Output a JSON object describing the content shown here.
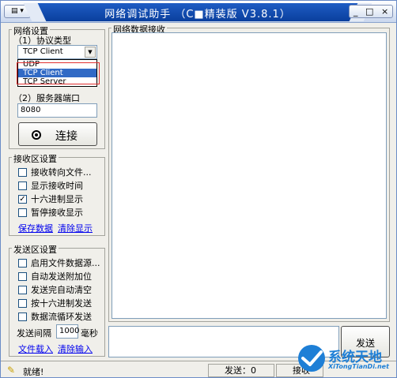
{
  "window": {
    "title": "网络调试助手 （C■精装版 V3.8.1）",
    "sysmenu_label": "▤ ▾",
    "min_label": "_",
    "max_label": "□",
    "close_label": "×"
  },
  "network": {
    "group_label": "网络设置",
    "protocol_label": "（1）协议类型",
    "protocol_value": "TCP Client",
    "protocol_options": [
      "UDP",
      "TCP Client",
      "TCP Server"
    ],
    "port_label": "（2）服务器端口",
    "port_value": "8080",
    "connect_label": "连接"
  },
  "receive": {
    "group_label": "接收区设置",
    "options": [
      {
        "label": "接收转向文件...",
        "checked": false
      },
      {
        "label": "显示接收时间",
        "checked": false
      },
      {
        "label": "十六进制显示",
        "checked": true
      },
      {
        "label": "暂停接收显示",
        "checked": false
      }
    ],
    "save_link": "保存数据",
    "clear_link": "清除显示",
    "data_label": "网络数据接收"
  },
  "send": {
    "group_label": "发送区设置",
    "options": [
      {
        "label": "启用文件数据源...",
        "checked": false
      },
      {
        "label": "自动发送附加位",
        "checked": false
      },
      {
        "label": "发送完自动清空",
        "checked": false
      },
      {
        "label": "按十六进制发送",
        "checked": false
      },
      {
        "label": "数据流循环发送",
        "checked": false
      }
    ],
    "interval_label": "发送间隔",
    "interval_value": "1000",
    "interval_unit": "毫秒",
    "file_link": "文件载入",
    "clear_link": "清除输入",
    "send_button": "发送"
  },
  "status": {
    "ready_text": "就绪!",
    "send_count": "发送：0",
    "recv_count": "接收"
  },
  "watermark": {
    "title": "系统天地",
    "subtitle": "XiTongTianDi.net"
  }
}
